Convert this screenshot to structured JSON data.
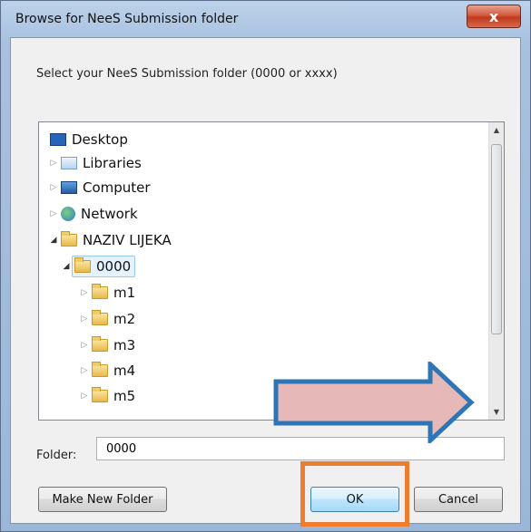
{
  "window": {
    "title": "Browse for NeeS Submission folder",
    "close_label": "x"
  },
  "dialog": {
    "instruction": "Select your NeeS Submission folder (0000 or xxxx)"
  },
  "tree": {
    "items": [
      {
        "label": "Desktop",
        "icon": "desktop-icon"
      },
      {
        "label": "Libraries",
        "icon": "libraries-icon"
      },
      {
        "label": "Computer",
        "icon": "computer-icon"
      },
      {
        "label": "Network",
        "icon": "network-icon"
      },
      {
        "label": "NAZIV LIJEKA",
        "icon": "folder-icon"
      },
      {
        "label": "0000",
        "icon": "folder-icon",
        "selected": true
      },
      {
        "label": "m1",
        "icon": "folder-icon"
      },
      {
        "label": "m2",
        "icon": "folder-icon"
      },
      {
        "label": "m3",
        "icon": "folder-icon"
      },
      {
        "label": "m4",
        "icon": "folder-icon"
      },
      {
        "label": "m5",
        "icon": "folder-icon"
      }
    ]
  },
  "folder": {
    "label": "Folder:",
    "value": "0000"
  },
  "buttons": {
    "make_new_folder": "Make New Folder",
    "ok": "OK",
    "cancel": "Cancel"
  },
  "colors": {
    "highlight_box": "#ed7d31",
    "arrow_fill": "#e6b9b8",
    "arrow_stroke": "#2e75b6"
  }
}
